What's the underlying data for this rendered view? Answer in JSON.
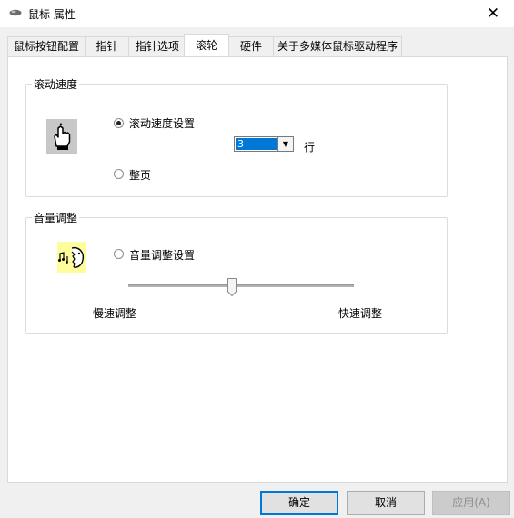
{
  "window": {
    "title": "鼠标 属性",
    "close_glyph": "✕"
  },
  "tabs": [
    {
      "label": "鼠标按钮配置",
      "active": false
    },
    {
      "label": "指针",
      "active": false
    },
    {
      "label": "指针选项",
      "active": false
    },
    {
      "label": "滚轮",
      "active": true
    },
    {
      "label": "硬件",
      "active": false
    },
    {
      "label": "关于多媒体鼠标驱动程序",
      "active": false
    }
  ],
  "scroll_speed": {
    "group_title": "滚动速度",
    "icon": "scroll-hand-icon",
    "option_lines_label": "滚动速度设置",
    "option_lines_selected": true,
    "lines_value": "3",
    "lines_unit": "行",
    "option_page_label": "整页",
    "option_page_selected": false
  },
  "volume": {
    "group_title": "音量调整",
    "icon": "volume-face-icon",
    "option_label": "音量调整设置",
    "option_selected": false,
    "slow_label": "慢速调整",
    "fast_label": "快速调整",
    "slider_level": 0.46
  },
  "buttons": {
    "ok": "确定",
    "cancel": "取消",
    "apply": "应用(A)"
  },
  "colors": {
    "accent": "#0078d7",
    "selection": "#0078d7"
  }
}
